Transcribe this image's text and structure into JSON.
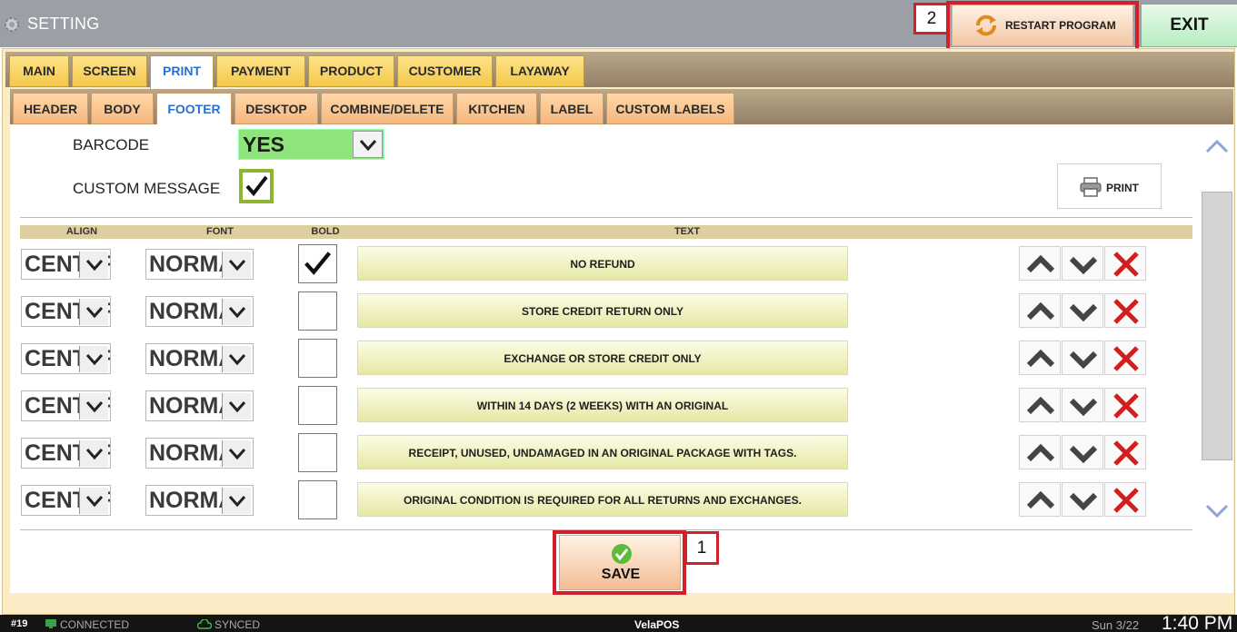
{
  "window": {
    "title": "SETTING",
    "restart_label": "RESTART PROGRAM",
    "exit_label": "EXIT",
    "callout_restart": "2",
    "callout_save": "1"
  },
  "main_tabs": [
    {
      "label": "MAIN"
    },
    {
      "label": "SCREEN"
    },
    {
      "label": "PRINT",
      "active": true
    },
    {
      "label": "PAYMENT"
    },
    {
      "label": "PRODUCT"
    },
    {
      "label": "CUSTOMER"
    },
    {
      "label": "LAYAWAY"
    }
  ],
  "sub_tabs": [
    {
      "label": "HEADER"
    },
    {
      "label": "BODY"
    },
    {
      "label": "FOOTER",
      "active": true
    },
    {
      "label": "DESKTOP"
    },
    {
      "label": "COMBINE/DELETE"
    },
    {
      "label": "KITCHEN"
    },
    {
      "label": "LABEL"
    },
    {
      "label": "CUSTOM LABELS"
    }
  ],
  "footer": {
    "barcode_label": "BARCODE",
    "barcode_value": "YES",
    "custom_message_label": "CUSTOM MESSAGE",
    "custom_message_checked": true,
    "print_label": "PRINT"
  },
  "grid": {
    "headers": {
      "align": "ALIGN",
      "font": "FONT",
      "bold": "BOLD",
      "text": "TEXT"
    },
    "rows": [
      {
        "align": "CENTER",
        "font": "NORMAL",
        "bold": true,
        "text": "NO REFUND"
      },
      {
        "align": "CENTER",
        "font": "NORMAL",
        "bold": false,
        "text": "STORE CREDIT RETURN ONLY"
      },
      {
        "align": "CENTER",
        "font": "NORMAL",
        "bold": false,
        "text": "EXCHANGE OR STORE CREDIT ONLY"
      },
      {
        "align": "CENTER",
        "font": "NORMAL",
        "bold": false,
        "text": "WITHIN 14 DAYS (2 WEEKS) WITH AN ORIGINAL"
      },
      {
        "align": "CENTER",
        "font": "NORMAL",
        "bold": false,
        "text": "RECEIPT, UNUSED, UNDAMAGED IN AN ORIGINAL PACKAGE WITH TAGS."
      },
      {
        "align": "CENTER",
        "font": "NORMAL",
        "bold": false,
        "text": "ORIGINAL CONDITION IS REQUIRED FOR ALL RETURNS AND EXCHANGES."
      }
    ]
  },
  "save_label": "SAVE",
  "status": {
    "station": "#19",
    "connection": "CONNECTED",
    "sync": "SYNCED",
    "app": "VelaPOS",
    "date": "Sun 3/22",
    "time": "1:40 PM"
  }
}
